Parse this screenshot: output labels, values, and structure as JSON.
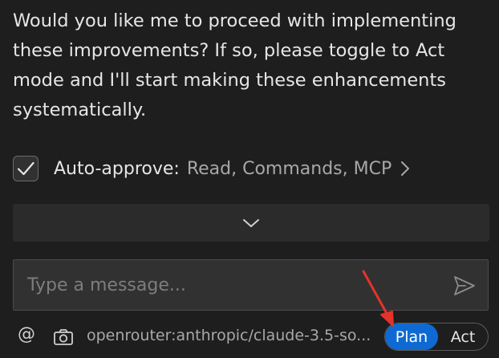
{
  "message": {
    "text": "Would you like me to proceed with implementing these improvements? If so, please toggle to Act mode and I'll start making these enhancements systematically."
  },
  "auto_approve": {
    "checked": true,
    "label": "Auto-approve:",
    "values": "Read, Commands, MCP",
    "icon": "chevron-right-icon"
  },
  "expand": {
    "icon": "chevron-down-icon"
  },
  "input": {
    "placeholder": "Type a message...",
    "value": "",
    "send_icon": "send-icon"
  },
  "footer": {
    "mention_label": "@",
    "camera_icon": "camera-icon",
    "model": "openrouter:anthropic/claude-3.5-so...",
    "modes": {
      "plan": "Plan",
      "act": "Act",
      "selected": "plan"
    }
  },
  "annotation": {
    "icon": "red-arrow-icon",
    "color": "#e3332b"
  },
  "colors": {
    "background": "#1e1e1e",
    "accent": "#0e6ad2"
  }
}
